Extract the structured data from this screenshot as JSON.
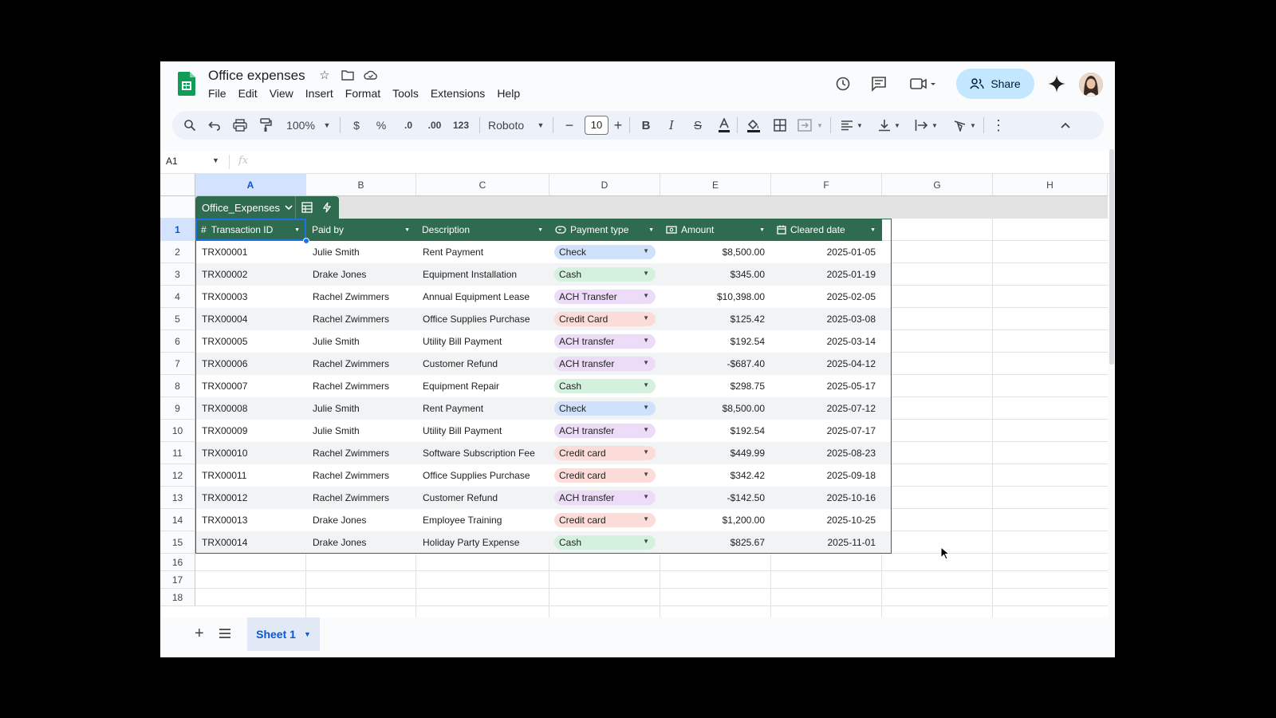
{
  "app": {
    "title": "Office expenses"
  },
  "menu": [
    "File",
    "Edit",
    "View",
    "Insert",
    "Format",
    "Tools",
    "Extensions",
    "Help"
  ],
  "header": {
    "share_label": "Share"
  },
  "toolbar": {
    "zoom": "100%",
    "font": "Roboto",
    "font_size": "10",
    "currency": "$",
    "percent": "%",
    "dec_decrease": ".0",
    "dec_increase": ".00",
    "number_format": "123"
  },
  "formula_bar": {
    "cell_ref": "A1",
    "fx": "fx"
  },
  "columns": [
    "A",
    "B",
    "C",
    "D",
    "E",
    "F",
    "G",
    "H"
  ],
  "rows": [
    "1",
    "2",
    "3",
    "4",
    "5",
    "6",
    "7",
    "8",
    "9",
    "10",
    "11",
    "12",
    "13",
    "14",
    "15",
    "16",
    "17",
    "18"
  ],
  "table": {
    "name": "Office_Expenses",
    "headers": [
      "Transaction ID",
      "Paid by",
      "Description",
      "Payment type",
      "Amount",
      "Cleared date"
    ],
    "rows": [
      [
        "TRX00001",
        "Julie Smith",
        "Rent Payment",
        "Check",
        "$8,500.00",
        "2025-01-05"
      ],
      [
        "TRX00002",
        "Drake Jones",
        "Equipment Installation",
        "Cash",
        "$345.00",
        "2025-01-19"
      ],
      [
        "TRX00003",
        "Rachel Zwimmers",
        "Annual Equipment Lease",
        "ACH Transfer",
        "$10,398.00",
        "2025-02-05"
      ],
      [
        "TRX00004",
        "Rachel Zwimmers",
        "Office Supplies Purchase",
        "Credit Card",
        "$125.42",
        "2025-03-08"
      ],
      [
        "TRX00005",
        "Julie Smith",
        "Utility Bill Payment",
        "ACH transfer",
        "$192.54",
        "2025-03-14"
      ],
      [
        "TRX00006",
        "Rachel Zwimmers",
        "Customer Refund",
        "ACH transfer",
        "-$687.40",
        "2025-04-12"
      ],
      [
        "TRX00007",
        "Rachel Zwimmers",
        "Equipment Repair",
        "Cash",
        "$298.75",
        "2025-05-17"
      ],
      [
        "TRX00008",
        "Julie Smith",
        "Rent Payment",
        "Check",
        "$8,500.00",
        "2025-07-12"
      ],
      [
        "TRX00009",
        "Julie Smith",
        "Utility Bill Payment",
        "ACH transfer",
        "$192.54",
        "2025-07-17"
      ],
      [
        "TRX00010",
        "Rachel Zwimmers",
        "Software Subscription Fee",
        "Credit card",
        "$449.99",
        "2025-08-23"
      ],
      [
        "TRX00011",
        "Rachel Zwimmers",
        "Office Supplies Purchase",
        "Credit card",
        "$342.42",
        "2025-09-18"
      ],
      [
        "TRX00012",
        "Rachel Zwimmers",
        "Customer Refund",
        "ACH transfer",
        "-$142.50",
        "2025-10-16"
      ],
      [
        "TRX00013",
        "Drake Jones",
        "Employee Training",
        "Credit card",
        "$1,200.00",
        "2025-10-25"
      ],
      [
        "TRX00014",
        "Drake Jones",
        "Holiday Party Expense",
        "Cash",
        "$825.67",
        "2025-11-01"
      ]
    ]
  },
  "chip_colors": {
    "Check": "#cfe1fb",
    "Cash": "#d4f1dd",
    "ACH": "#ecdcf8",
    "Credit": "#fbdcd8"
  },
  "sheet_tab": "Sheet 1",
  "colors": {
    "table_header": "#2f6b4f",
    "accent": "#0b57d0",
    "share_bg": "#c2e7ff"
  }
}
